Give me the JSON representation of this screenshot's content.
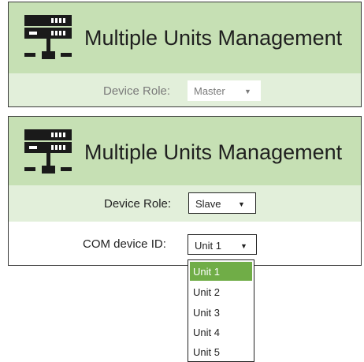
{
  "panel1": {
    "title": "Multiple Units Management",
    "device_role_label": "Device Role:",
    "device_role_value": "Master"
  },
  "panel2": {
    "title": "Multiple Units Management",
    "device_role_label": "Device Role:",
    "device_role_value": "Slave",
    "com_device_id_label": "COM device ID:",
    "com_device_id_value": "Unit 1",
    "dropdown_options": [
      "Unit 1",
      "Unit 2",
      "Unit 3",
      "Unit 4",
      "Unit 5"
    ],
    "selected_option": "Unit 1"
  },
  "icons": {
    "header_icon": "network-server-icon",
    "dropdown_caret": "chevron-down-icon"
  },
  "colors": {
    "header_bg": "#c6e0b4",
    "role_row_bg": "#e2efda",
    "selected_option_bg": "#70ad47"
  }
}
